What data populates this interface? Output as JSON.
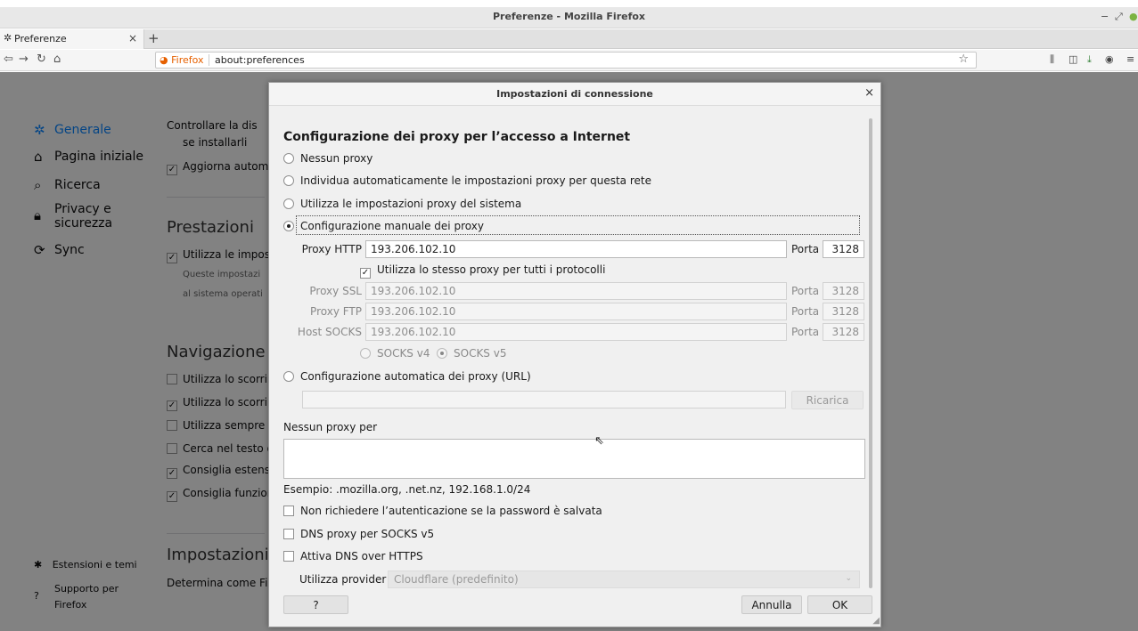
{
  "window": {
    "title": "Preferenze - Mozilla Firefox"
  },
  "tab": {
    "label": "Preferenze"
  },
  "urlbar": {
    "identity": "Firefox",
    "url": "about:preferences"
  },
  "sidebar": {
    "items": [
      {
        "label": "Generale"
      },
      {
        "label": "Pagina iniziale"
      },
      {
        "label": "Ricerca"
      },
      {
        "label": "Privacy e sicurezza"
      },
      {
        "label": "Sync"
      }
    ],
    "footer": [
      {
        "label": "Estensioni e temi"
      },
      {
        "label": "Supporto per Firefox"
      }
    ]
  },
  "page": {
    "row_controllare": "Controllare la dis",
    "row_installarli": "se installarli",
    "row_aggiorna": "Aggiorna autom",
    "h_prestazioni": "Prestazioni",
    "row_utilizza_impost": "Utilizza le impost",
    "sub_queste": "Queste impostazi",
    "sub_sistema": "al sistema operati",
    "h_navigazione": "Navigazione",
    "nav_rows": [
      "Utilizza lo scorrin",
      "Utilizza lo scorrin",
      "Utilizza sempre i",
      "Cerca nel testo q",
      "Consiglia estensi",
      "Consiglia funzion"
    ],
    "h_impostazioni": "Impostazioni c",
    "row_determina": "Determina come Fir"
  },
  "dialog": {
    "title": "Impostazioni di connessione",
    "heading": "Configurazione dei proxy per l’accesso a Internet",
    "radios": {
      "no_proxy": "Nessun proxy",
      "auto_detect": "Individua automaticamente le impostazioni proxy per questa rete",
      "system": "Utilizza le impostazioni proxy del sistema",
      "manual": "Configurazione manuale dei proxy",
      "auto_url": "Configurazione automatica dei proxy (URL)"
    },
    "http": {
      "label": "Proxy HTTP",
      "value": "193.206.102.10",
      "port_label": "Porta",
      "port": "3128"
    },
    "same_proxy": "Utilizza lo stesso proxy per tutti i protocolli",
    "ssl": {
      "label": "Proxy SSL",
      "value": "193.206.102.10",
      "port_label": "Porta",
      "port": "3128"
    },
    "ftp": {
      "label": "Proxy FTP",
      "value": "193.206.102.10",
      "port_label": "Porta",
      "port": "3128"
    },
    "socks": {
      "label": "Host SOCKS",
      "value": "193.206.102.10",
      "port_label": "Porta",
      "port": "3128"
    },
    "socks_v4": "SOCKS v4",
    "socks_v5": "SOCKS v5",
    "reload": "Ricarica",
    "no_proxy_for": "Nessun proxy per",
    "example": "Esempio: .mozilla.org, .net.nz, 192.168.1.0/24",
    "no_auth": "Non richiedere l’autenticazione se la password è salvata",
    "dns_socks": "DNS proxy per SOCKS v5",
    "doh": "Attiva DNS over HTTPS",
    "provider_label": "Utilizza provider",
    "provider_value": "Cloudflare (predefinito)",
    "help": "?",
    "cancel": "Annulla",
    "ok": "OK"
  }
}
